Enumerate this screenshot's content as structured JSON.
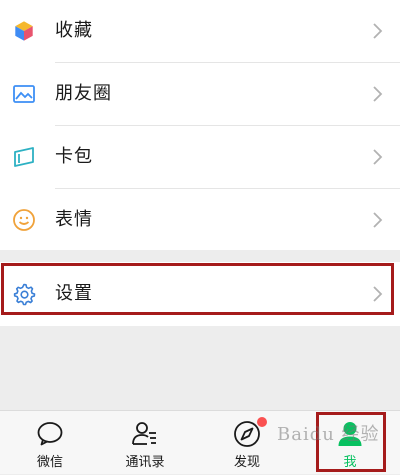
{
  "menu": {
    "items": [
      {
        "label": "收藏",
        "icon": "favorites-cube-icon"
      },
      {
        "label": "朋友圈",
        "icon": "moments-picture-icon"
      },
      {
        "label": "卡包",
        "icon": "card-wallet-icon"
      },
      {
        "label": "表情",
        "icon": "sticker-smile-icon"
      }
    ],
    "settings": {
      "label": "设置",
      "icon": "gear-icon"
    }
  },
  "tabbar": {
    "tabs": [
      {
        "label": "微信",
        "icon": "chat-bubble-icon"
      },
      {
        "label": "通讯录",
        "icon": "contacts-icon"
      },
      {
        "label": "发现",
        "icon": "compass-icon",
        "badge": true
      },
      {
        "label": "我",
        "icon": "me-person-icon",
        "active": true
      }
    ]
  },
  "watermark": {
    "text": "Baidu 经验"
  },
  "colors": {
    "accent": "#07c160",
    "highlight_box": "#a51b1b",
    "badge": "#fa5151",
    "background": "#ededed"
  }
}
